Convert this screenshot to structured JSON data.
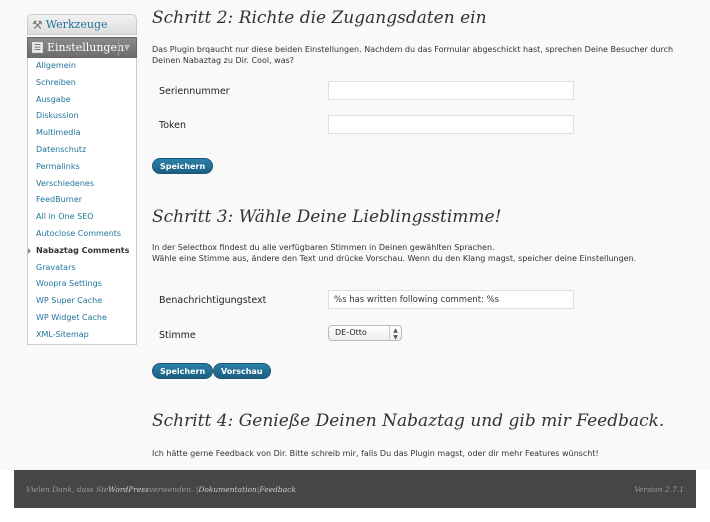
{
  "sidebar": {
    "tools_label": "Werkzeuge",
    "settings_label": "Einstellungen",
    "items": [
      {
        "label": "Allgemein"
      },
      {
        "label": "Schreiben"
      },
      {
        "label": "Ausgabe"
      },
      {
        "label": "Diskussion"
      },
      {
        "label": "Multimedia"
      },
      {
        "label": "Datenschutz"
      },
      {
        "label": "Permalinks"
      },
      {
        "label": "Verschiedenes"
      },
      {
        "label": "FeedBurner"
      },
      {
        "label": "All in One SEO"
      },
      {
        "label": "Autoclose Comments"
      },
      {
        "label": "Nabaztag Comments"
      },
      {
        "label": "Gravatars"
      },
      {
        "label": "Woopra Settings"
      },
      {
        "label": "WP Super Cache"
      },
      {
        "label": "WP Widget Cache"
      },
      {
        "label": "XML-Sitemap"
      }
    ],
    "current_index": 11
  },
  "step2": {
    "heading": "Schritt 2: Richte die Zugangsdaten ein",
    "text": "Das Plugin brqaucht nur diese beiden Einstellungen. Nachdem du das Formular abgeschickt hast, sprechen Deine Besucher durch Deinen Nabaztag zu Dir. Cool, was?",
    "serial_label": "Seriennummer",
    "serial_value": "",
    "token_label": "Token",
    "token_value": "",
    "save_label": "Speichern"
  },
  "step3": {
    "heading": "Schritt 3: Wähle Deine Lieblingsstimme!",
    "text": "In der Selectbox findest du alle verfügbaren Stimmen in Deinen gewählten Sprachen.\nWähle eine Stimme aus, ändere den Text und drücke Vorschau. Wenn du den Klang magst, speicher deine Einstellungen.",
    "notify_label": "Benachrichtigungstext",
    "notify_value": "%s has written following comment: %s",
    "voice_label": "Stimme",
    "voice_value": "DE-Otto",
    "save_label": "Speichern",
    "preview_label": "Vorschau"
  },
  "step4": {
    "heading": "Schritt 4: Genieße Deinen Nabaztag und gib mir Feedback.",
    "text": "Ich hätte gerne Feedback von Dir. Bitte schreib mir, falls Du das Plugin magst, oder dir mehr Features wünscht!"
  },
  "footer": {
    "thanks_prefix": "Vielen Dank, dass Sie ",
    "wordpress": "WordPress",
    "thanks_suffix": " verwenden. | ",
    "docs": "Dokumentation",
    "sep": " | ",
    "feedback": "Feedback",
    "version": "Version 2.7.1"
  }
}
